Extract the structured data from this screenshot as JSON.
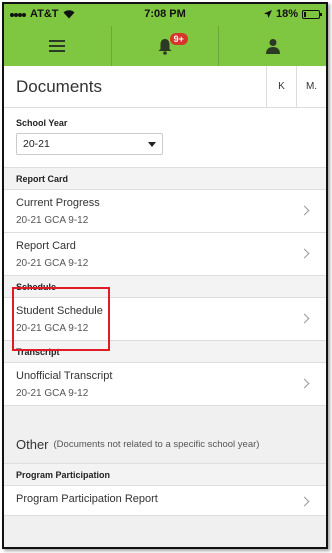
{
  "status_bar": {
    "carrier": "AT&T",
    "time": "7:08 PM",
    "battery_pct": "18%",
    "battery_level": 0.18
  },
  "nav": {
    "menu_icon": "hamburger-icon",
    "notifications_icon": "bell-icon",
    "notifications_badge": "9+",
    "profile_icon": "person-icon"
  },
  "header": {
    "title": "Documents",
    "tabs": [
      "K",
      "M."
    ]
  },
  "school_year": {
    "label": "School Year",
    "value": "20-21"
  },
  "sections": [
    {
      "heading": "Report Card",
      "items": [
        {
          "name": "Current Progress",
          "sub": "20-21 GCA 9-12"
        },
        {
          "name": "Report Card",
          "sub": "20-21 GCA 9-12"
        }
      ]
    },
    {
      "heading": "Schedule",
      "items": [
        {
          "name": "Student Schedule",
          "sub": "20-21 GCA 9-12"
        }
      ]
    },
    {
      "heading": "Transcript",
      "items": [
        {
          "name": "Unofficial Transcript",
          "sub": "20-21 GCA 9-12"
        }
      ]
    }
  ],
  "other": {
    "heading": "Other",
    "note": "(Documents not related to a specific school year)"
  },
  "program": {
    "heading": "Program Participation",
    "item": "Program Participation Report"
  },
  "colors": {
    "nav_green": "#7fc641",
    "badge_red": "#d9342b",
    "highlight_red": "#e01b24"
  }
}
